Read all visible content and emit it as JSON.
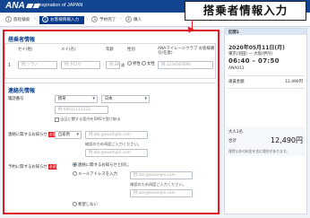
{
  "brand": {
    "logo": "ANA",
    "tagline": "Inspiration of JAPAN"
  },
  "callout": "搭乗者情報入力",
  "steps": [
    {
      "num": "1",
      "label": "旅程検索"
    },
    {
      "num": "2",
      "label": "お客様情報入力"
    },
    {
      "num": "3",
      "label": "予約完了"
    },
    {
      "num": "4",
      "label": "購入"
    }
  ],
  "passenger": {
    "title": "搭乗者情報",
    "headers": {
      "surname": "セイ(姓)",
      "given": "メイ(名)",
      "age": "年齢",
      "gender": "性別",
      "mileage": "ANAマイレージクラブ お客様番号(任意)"
    },
    "row_num": "1",
    "surname_placeholder": "例:ソラノ",
    "given_placeholder": "例:タロウ",
    "age_placeholder": "例:36",
    "age_unit": "歳",
    "gender_options": [
      "男性",
      "女性"
    ],
    "mileage_placeholder": "例:1234567890"
  },
  "contact": {
    "title": "連絡先情報",
    "phone_label": "電話番号",
    "phone_type": "携帯",
    "country": "日本",
    "phone_placeholder": "例:09011112222",
    "sms_note": "当日に関する案内をSMSで受け取る",
    "email_label": "連絡に関するお知らせ",
    "required": "必須",
    "email_type": "自家用",
    "email_placeholder": "例:abc@example.com",
    "email_confirm_note": "確認のため再度ご入力ください。",
    "email_confirm_placeholder": "例:abc@example.com",
    "notify_label": "予約に関するお知らせ",
    "notify_opt1": "連絡に関するお知らせと同じ",
    "notify_opt2": "メールアドレスを入力",
    "notify_opt3": "希望しない",
    "notify_email_placeholder": "例:abc@example.com",
    "notify_confirm_note": "確認のため再度ご入力ください。",
    "notify_confirm_placeholder": "例:abc@example.com"
  },
  "summary": {
    "flight": "区間1",
    "date": "2020年05月11日(月)",
    "route": "東京(羽田) ― 大阪(伊丹)",
    "time": "06:40 – 07:50",
    "flight_no": "ANA011",
    "fare_label": "運賃金額",
    "fare_value": "12,490円",
    "pax_label": "大人1名",
    "total_label": "合計",
    "total_value": "12,490円",
    "note": "運賃以外の料金を含む場合があります。"
  },
  "colors": {
    "brand": "#13448f",
    "accent": "#e01b24"
  }
}
